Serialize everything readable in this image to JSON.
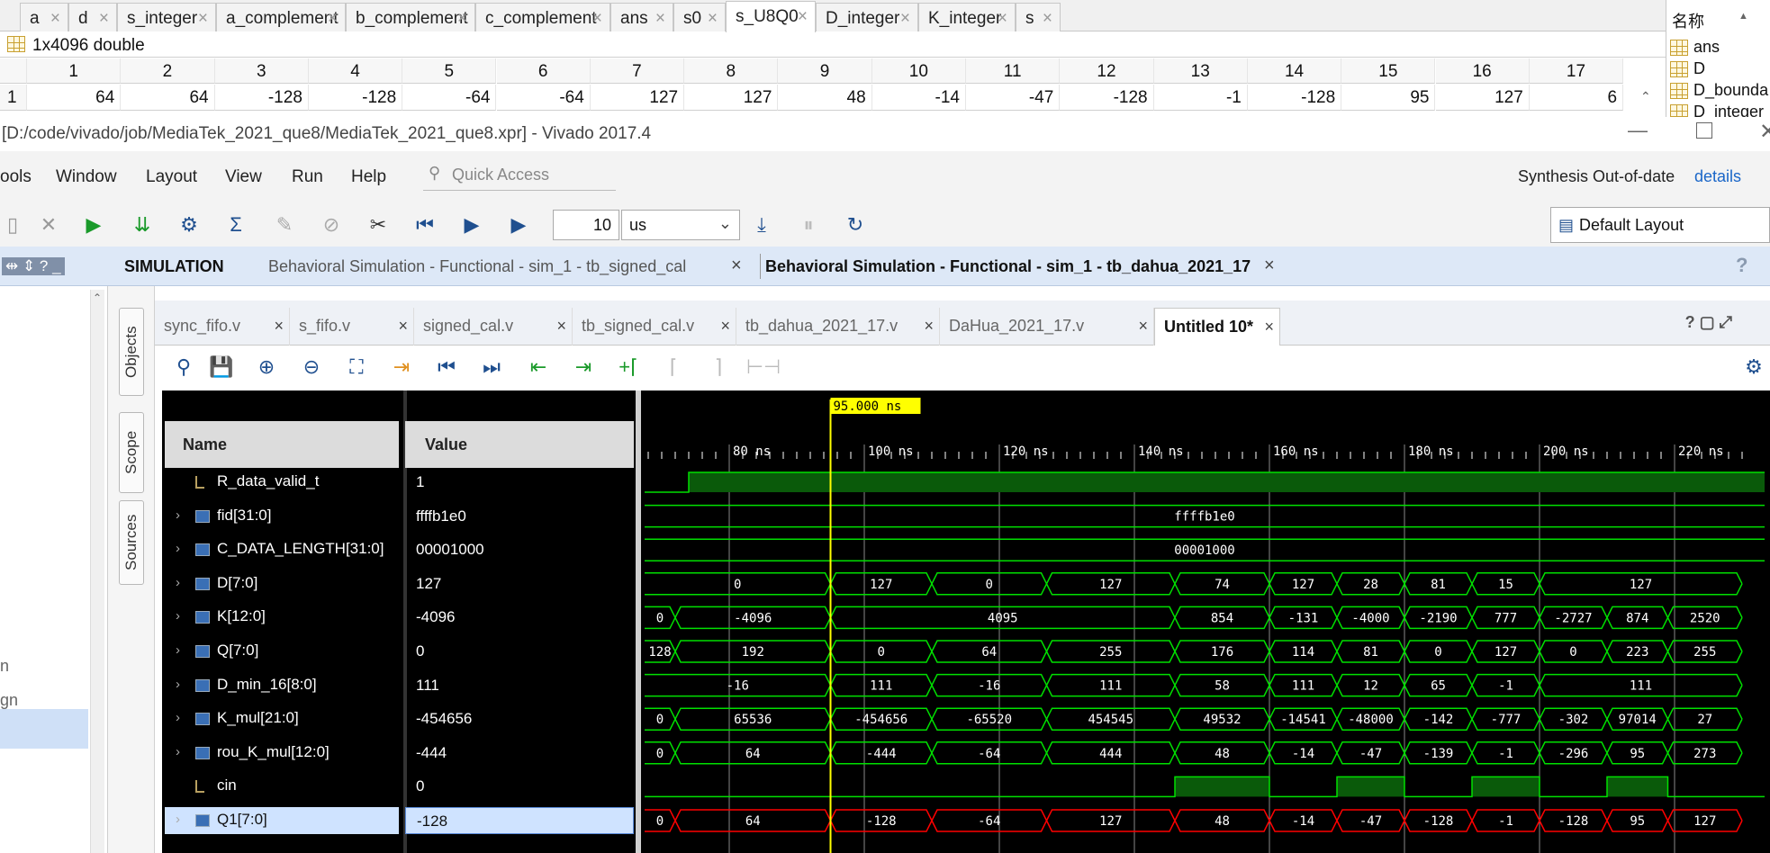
{
  "matlab": {
    "tabs": [
      "a",
      "d",
      "s_integer",
      "a_complement",
      "b_complement",
      "c_complement",
      "ans",
      "s0",
      "s_U8Q0",
      "D_integer",
      "K_integer",
      "s"
    ],
    "active_tab": "s_U8Q0",
    "var_type": "1x4096 double",
    "col_headers": [
      "1",
      "2",
      "3",
      "4",
      "5",
      "6",
      "7",
      "8",
      "9",
      "10",
      "11",
      "12",
      "13",
      "14",
      "15",
      "16",
      "17"
    ],
    "row_label": "1",
    "row_values": [
      "64",
      "64",
      "-128",
      "-128",
      "-64",
      "-64",
      "127",
      "127",
      "48",
      "-14",
      "-47",
      "-128",
      "-1",
      "-128",
      "95",
      "127",
      "6"
    ],
    "workspace_header": "名称",
    "workspace_items": [
      "ans",
      "D",
      "D_bounda",
      "D_integer"
    ]
  },
  "vivado": {
    "title": "[D:/code/vivado/job/MediaTek_2021_que8/MediaTek_2021_que8.xpr] - Vivado 2017.4",
    "menus": [
      "ools",
      "Window",
      "Layout",
      "View",
      "Run",
      "Help"
    ],
    "quick_access_placeholder": "Quick Access",
    "synth_status": "Synthesis Out-of-date",
    "details_link": "details",
    "run_time": "10",
    "run_unit": "us",
    "layout_select": "Default Layout",
    "sim_label": "SIMULATION",
    "sim_tab1": "Behavioral Simulation - Functional - sim_1 - tb_signed_cal",
    "sim_tab2": "Behavioral Simulation - Functional - sim_1 - tb_dahua_2021_17",
    "side_tabs": [
      "Objects",
      "Scope",
      "Sources"
    ],
    "left_partial": [
      "n",
      "gn"
    ],
    "file_tabs": [
      "sync_fifo.v",
      "s_fifo.v",
      "signed_cal.v",
      "tb_signed_cal.v",
      "tb_dahua_2021_17.v",
      "DaHua_2021_17.v",
      "Untitled 10*"
    ],
    "cursor_label": "95.000 ns",
    "name_header": "Name",
    "value_header": "Value",
    "time_ticks": [
      "80 ns",
      "100 ns",
      "120 ns",
      "140 ns",
      "160 ns",
      "180 ns",
      "200 ns",
      "220 ns"
    ],
    "signals": [
      {
        "name": "R_data_valid_t",
        "value": "1",
        "bus": false
      },
      {
        "name": "fid[31:0]",
        "value": "ffffb1e0",
        "bus": true
      },
      {
        "name": "C_DATA_LENGTH[31:0]",
        "value": "00001000",
        "bus": true
      },
      {
        "name": "D[7:0]",
        "value": "127",
        "bus": true
      },
      {
        "name": "K[12:0]",
        "value": "-4096",
        "bus": true
      },
      {
        "name": "Q[7:0]",
        "value": "0",
        "bus": true
      },
      {
        "name": "D_min_16[8:0]",
        "value": "111",
        "bus": true
      },
      {
        "name": "K_mul[21:0]",
        "value": "-454656",
        "bus": true
      },
      {
        "name": "rou_K_mul[12:0]",
        "value": "-444",
        "bus": true
      },
      {
        "name": "cin",
        "value": "0",
        "bus": false
      },
      {
        "name": "Q1[7:0]",
        "value": "-128",
        "bus": true
      }
    ],
    "bus_waves": [
      {
        "row": 1,
        "segments": [
          {
            "v": "ffffb1e0"
          }
        ]
      },
      {
        "row": 2,
        "segments": [
          {
            "v": "00001000"
          }
        ]
      },
      {
        "row": 3,
        "segments": [
          {
            "v": "0"
          },
          {
            "v": "127"
          },
          {
            "v": "0"
          },
          {
            "v": "127"
          },
          {
            "v": "74"
          },
          {
            "v": "127"
          },
          {
            "v": "28"
          },
          {
            "v": "81"
          },
          {
            "v": "15"
          },
          {
            "v": "127"
          }
        ]
      },
      {
        "row": 4,
        "segments": [
          {
            "v": "0"
          },
          {
            "v": "-4096"
          },
          {
            "v": "4095"
          },
          {
            "v": "854"
          },
          {
            "v": "-131"
          },
          {
            "v": "-4000"
          },
          {
            "v": "-2190"
          },
          {
            "v": "777"
          },
          {
            "v": "-2727"
          },
          {
            "v": "874"
          },
          {
            "v": "2520"
          }
        ]
      },
      {
        "row": 5,
        "segments": [
          {
            "v": "128"
          },
          {
            "v": "192"
          },
          {
            "v": "0"
          },
          {
            "v": "64"
          },
          {
            "v": "255"
          },
          {
            "v": "176"
          },
          {
            "v": "114"
          },
          {
            "v": "81"
          },
          {
            "v": "0"
          },
          {
            "v": "127"
          },
          {
            "v": "0"
          },
          {
            "v": "223"
          },
          {
            "v": "255"
          }
        ]
      },
      {
        "row": 6,
        "segments": [
          {
            "v": "-16"
          },
          {
            "v": "111"
          },
          {
            "v": "-16"
          },
          {
            "v": "111"
          },
          {
            "v": "58"
          },
          {
            "v": "111"
          },
          {
            "v": "12"
          },
          {
            "v": "65"
          },
          {
            "v": "-1"
          },
          {
            "v": "111"
          }
        ]
      },
      {
        "row": 7,
        "segments": [
          {
            "v": "0"
          },
          {
            "v": "65536"
          },
          {
            "v": "-454656"
          },
          {
            "v": "-65520"
          },
          {
            "v": "454545"
          },
          {
            "v": "49532"
          },
          {
            "v": "-14541"
          },
          {
            "v": "-48000"
          },
          {
            "v": "-142"
          },
          {
            "v": "-777"
          },
          {
            "v": "-302"
          },
          {
            "v": "97014"
          },
          {
            "v": "27"
          }
        ]
      },
      {
        "row": 8,
        "segments": [
          {
            "v": "0"
          },
          {
            "v": "64"
          },
          {
            "v": "-444"
          },
          {
            "v": "-64"
          },
          {
            "v": "444"
          },
          {
            "v": "48"
          },
          {
            "v": "-14"
          },
          {
            "v": "-47"
          },
          {
            "v": "-139"
          },
          {
            "v": "-1"
          },
          {
            "v": "-296"
          },
          {
            "v": "95"
          },
          {
            "v": "273"
          }
        ]
      },
      {
        "row": 10,
        "segments": [
          {
            "v": "0"
          },
          {
            "v": "64"
          },
          {
            "v": "-128"
          },
          {
            "v": "-64"
          },
          {
            "v": "127"
          },
          {
            "v": "48"
          },
          {
            "v": "-14"
          },
          {
            "v": "-47"
          },
          {
            "v": "-128"
          },
          {
            "v": "-1"
          },
          {
            "v": "-128"
          },
          {
            "v": "95"
          },
          {
            "v": "127"
          }
        ]
      }
    ],
    "colors": {
      "wave": "#00e000",
      "selected_wave": "#ff0000",
      "cursor": "#ffff00",
      "bg": "#000000"
    }
  }
}
